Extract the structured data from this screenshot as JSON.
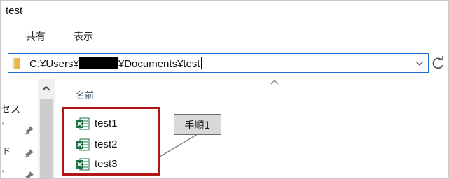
{
  "window": {
    "title": "test"
  },
  "ribbon": {
    "tabs": [
      "共有",
      "表示"
    ]
  },
  "address": {
    "prefix": "C:¥Users¥",
    "suffix": "¥Documents¥test"
  },
  "nav": {
    "partial_label": "セス",
    "marks": [
      "'",
      "ド",
      "'"
    ]
  },
  "columns": {
    "name": "名前"
  },
  "files": [
    {
      "name": "test1",
      "icon": "excel-file-icon"
    },
    {
      "name": "test2",
      "icon": "excel-file-icon"
    },
    {
      "name": "test3",
      "icon": "excel-file-icon"
    }
  ],
  "annotation": {
    "label": "手順1",
    "highlight_color": "#b01616"
  }
}
